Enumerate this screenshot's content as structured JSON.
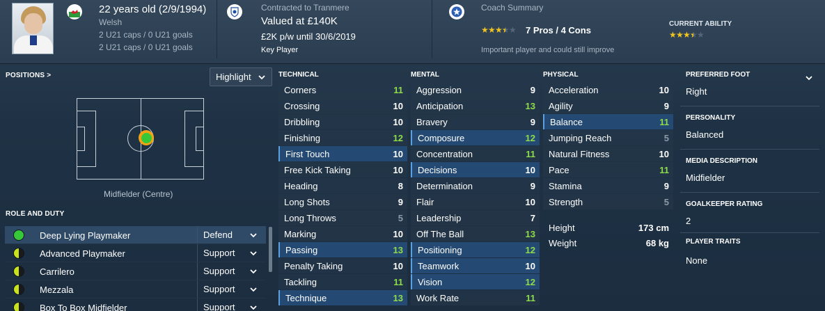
{
  "header": {
    "age": "22 years old (2/9/1994)",
    "nationality": "Welsh",
    "u21_caps_1": "2 U21 caps / 0 U21 goals",
    "u21_caps_2": "2 U21 caps / 0 U21 goals",
    "contract_label": "Contracted to Tranmere",
    "value": "Valued at £140K",
    "wage": "£2K p/w until 30/6/2019",
    "role_status": "Key Player",
    "coach_label": "Coach Summary",
    "pros_cons": "7 Pros / 4 Cons",
    "coach_note": "Important player and could still improve",
    "current_ability_label": "CURRENT ABILITY",
    "coach_stars": 3.5,
    "ability_stars": 3.5
  },
  "positions": {
    "heading": "POSITIONS >",
    "dropdown_value": "Highlight",
    "caption": "Midfielder (Centre)"
  },
  "roles": {
    "heading": "ROLE AND DUTY",
    "items": [
      {
        "name": "Deep Lying Playmaker",
        "duty": "Defend",
        "icon": "full-green"
      },
      {
        "name": "Advanced Playmaker",
        "duty": "Support",
        "icon": "half"
      },
      {
        "name": "Carrilero",
        "duty": "Support",
        "icon": "half"
      },
      {
        "name": "Mezzala",
        "duty": "Support",
        "icon": "half"
      },
      {
        "name": "Box To Box Midfielder",
        "duty": "Support",
        "icon": "half"
      }
    ]
  },
  "technical": {
    "heading": "TECHNICAL",
    "items": [
      {
        "name": "Corners",
        "value": "11",
        "tone": "green",
        "hl": false
      },
      {
        "name": "Crossing",
        "value": "10",
        "tone": "white",
        "hl": false
      },
      {
        "name": "Dribbling",
        "value": "10",
        "tone": "white",
        "hl": false
      },
      {
        "name": "Finishing",
        "value": "12",
        "tone": "green",
        "hl": false
      },
      {
        "name": "First Touch",
        "value": "10",
        "tone": "white",
        "hl": true
      },
      {
        "name": "Free Kick Taking",
        "value": "10",
        "tone": "white",
        "hl": false
      },
      {
        "name": "Heading",
        "value": "8",
        "tone": "white",
        "hl": false
      },
      {
        "name": "Long Shots",
        "value": "9",
        "tone": "white",
        "hl": false
      },
      {
        "name": "Long Throws",
        "value": "5",
        "tone": "grey",
        "hl": false
      },
      {
        "name": "Marking",
        "value": "10",
        "tone": "white",
        "hl": false
      },
      {
        "name": "Passing",
        "value": "13",
        "tone": "green",
        "hl": true
      },
      {
        "name": "Penalty Taking",
        "value": "10",
        "tone": "white",
        "hl": false
      },
      {
        "name": "Tackling",
        "value": "11",
        "tone": "green",
        "hl": false
      },
      {
        "name": "Technique",
        "value": "13",
        "tone": "green",
        "hl": true
      }
    ]
  },
  "mental": {
    "heading": "MENTAL",
    "items": [
      {
        "name": "Aggression",
        "value": "9",
        "tone": "white",
        "hl": false
      },
      {
        "name": "Anticipation",
        "value": "13",
        "tone": "green",
        "hl": false
      },
      {
        "name": "Bravery",
        "value": "9",
        "tone": "white",
        "hl": false
      },
      {
        "name": "Composure",
        "value": "12",
        "tone": "green",
        "hl": true
      },
      {
        "name": "Concentration",
        "value": "11",
        "tone": "green",
        "hl": false
      },
      {
        "name": "Decisions",
        "value": "10",
        "tone": "white",
        "hl": true
      },
      {
        "name": "Determination",
        "value": "9",
        "tone": "white",
        "hl": false
      },
      {
        "name": "Flair",
        "value": "10",
        "tone": "white",
        "hl": false
      },
      {
        "name": "Leadership",
        "value": "7",
        "tone": "white",
        "hl": false
      },
      {
        "name": "Off The Ball",
        "value": "13",
        "tone": "green",
        "hl": false
      },
      {
        "name": "Positioning",
        "value": "12",
        "tone": "green",
        "hl": true
      },
      {
        "name": "Teamwork",
        "value": "10",
        "tone": "white",
        "hl": true
      },
      {
        "name": "Vision",
        "value": "12",
        "tone": "green",
        "hl": true
      },
      {
        "name": "Work Rate",
        "value": "11",
        "tone": "green",
        "hl": false
      }
    ]
  },
  "physical": {
    "heading": "PHYSICAL",
    "items": [
      {
        "name": "Acceleration",
        "value": "10",
        "tone": "white",
        "hl": false
      },
      {
        "name": "Agility",
        "value": "9",
        "tone": "white",
        "hl": false
      },
      {
        "name": "Balance",
        "value": "11",
        "tone": "green",
        "hl": true
      },
      {
        "name": "Jumping Reach",
        "value": "5",
        "tone": "grey",
        "hl": false
      },
      {
        "name": "Natural Fitness",
        "value": "10",
        "tone": "white",
        "hl": false
      },
      {
        "name": "Pace",
        "value": "11",
        "tone": "green",
        "hl": false
      },
      {
        "name": "Stamina",
        "value": "9",
        "tone": "white",
        "hl": false
      },
      {
        "name": "Strength",
        "value": "5",
        "tone": "grey",
        "hl": false
      }
    ],
    "height_label": "Height",
    "height_value": "173 cm",
    "weight_label": "Weight",
    "weight_value": "68 kg"
  },
  "side": {
    "preferred_foot_label": "PREFERRED FOOT",
    "preferred_foot": "Right",
    "personality_label": "PERSONALITY",
    "personality": "Balanced",
    "media_label": "MEDIA DESCRIPTION",
    "media": "Midfielder",
    "gk_label": "GOALKEEPER RATING",
    "gk": "2",
    "traits_label": "PLAYER TRAITS",
    "traits": "None"
  },
  "colors": {
    "green_value": "#8fdc4b",
    "grey_value": "#8d9aa7",
    "star": "#f2c41f",
    "highlight_row": "#244a73"
  }
}
